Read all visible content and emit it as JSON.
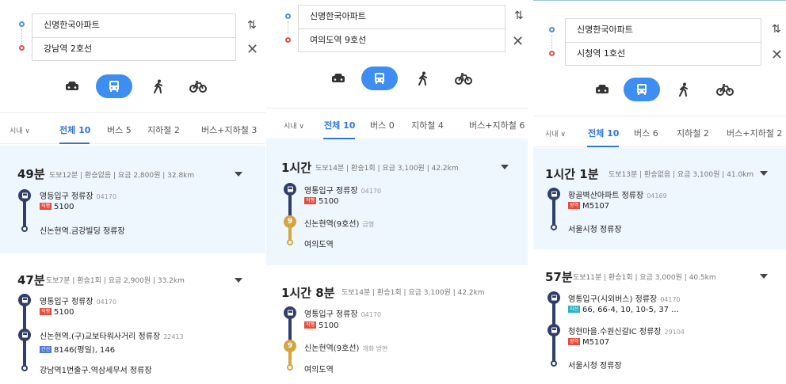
{
  "colors": {
    "accent": "#3d8ef0",
    "tab_active": "#2d76d9",
    "bus_line": "#2f3e6a",
    "subway_line9": "#d4a640",
    "badge_direct": "#e84b3c",
    "badge_trunk": "#4a7bd9",
    "badge_wide": "#e84b3c",
    "badge_branch": "#2bb3c0",
    "selected_bg": "#eef6fe"
  },
  "panels": [
    {
      "origin": "신명한국아파트",
      "destination": "강남역 2호선",
      "tabs": {
        "area": "시내 ∨",
        "all": "전체 10",
        "bus": "버스 5",
        "subway": "지하철 2",
        "bus_subway": "버스+지하철 3"
      },
      "routes": [
        {
          "time": "49분",
          "meta": "도보12분 | 환승없음 | 요금 2,800원 | 32.8km",
          "stop1": "영등입구 정류장",
          "stop1_id": "04170",
          "badge1": "직행",
          "line1": "5100",
          "end": "신논현역.금강빌딩 정류장"
        },
        {
          "time": "47분",
          "meta": "도보7분 | 환승1회 | 요금 2,900원 | 33.2km",
          "stop1": "영통입구 정류장",
          "stop1_id": "04170",
          "badge1": "직행",
          "line1": "5100",
          "stop2": "신논현역.(구)교보타워사거리 정류장",
          "stop2_id": "22413",
          "badge2": "간선",
          "line2": "8146(평일), 146",
          "end": "강남역1번출구.역삼세무서 정류장"
        }
      ]
    },
    {
      "origin": "신명한국아파트",
      "destination": "여의도역 9호선",
      "tabs": {
        "area": "시내 ∨",
        "all": "전체 10",
        "bus": "버스 0",
        "subway": "지하철 4",
        "bus_subway": "버스+지하철 6"
      },
      "routes": [
        {
          "time": "1시간",
          "meta": "도보14분 | 환승1회 | 요금 3,100원 | 42.2km",
          "stop1": "영통입구 정류장",
          "stop1_id": "04170",
          "badge1": "직행",
          "line1": "5100",
          "stop2": "신논현역(9호선)",
          "stop2_sub": "급행",
          "subway_num": "9",
          "end": "여의도역"
        },
        {
          "time": "1시간 8분",
          "meta": "도보14분 | 환승1회 | 요금 3,100원 | 42.2km",
          "stop1": "영통입구 정류장",
          "stop1_id": "04170",
          "badge1": "직행",
          "line1": "5100",
          "stop2": "신논현역(9호선)",
          "stop2_sub": "개화 방면",
          "subway_num": "9",
          "end": "여의도역"
        }
      ]
    },
    {
      "origin": "신명한국아파트",
      "destination": "시청역 1호선",
      "tabs": {
        "area": "시내 ∨",
        "all": "전체 10",
        "bus": "버스 6",
        "subway": "지하철 2",
        "bus_subway": "버스+지하철 2"
      },
      "routes": [
        {
          "time": "1시간 1분",
          "meta": "도보13분 | 환승없음 | 요금 3,100원 | 41.0km",
          "stop1": "황골벽산아파트 정류장",
          "stop1_id": "04169",
          "badge1": "광역",
          "line1": "M5107",
          "end": "서울시청 정류장"
        },
        {
          "time": "57분",
          "meta": "도보11분 | 환승1회 | 요금 3,000원 | 40.5km",
          "stop1": "영통입구(시외버스) 정류장",
          "stop1_id": "04170",
          "badge1": "지선",
          "line1": "66, 66-4, 10, 10-5, 37 ...",
          "stop2": "청현마을.수원신갈IC 정류장",
          "stop2_id": "29104",
          "badge2": "광역",
          "line2": "M5107",
          "end": "서울시청 정류장"
        }
      ]
    }
  ]
}
